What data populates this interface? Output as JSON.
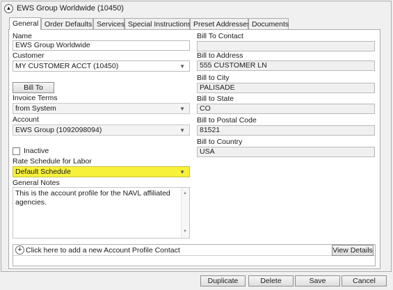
{
  "window": {
    "title": "EWS Group Worldwide (10450)"
  },
  "tabs": [
    {
      "label": "General",
      "active": true
    },
    {
      "label": "Order Defaults"
    },
    {
      "label": "Services"
    },
    {
      "label": "Special Instructions"
    },
    {
      "label": "Preset Addresses"
    },
    {
      "label": "Documents"
    }
  ],
  "general": {
    "name_label": "Name",
    "name_value": "EWS Group Worldwide",
    "customer_label": "Customer",
    "customer_value": "MY CUSTOMER ACCT (10450)",
    "bill_to_button": "Bill To",
    "invoice_terms_label": "Invoice Terms",
    "invoice_terms_value": "from System",
    "account_label": "Account",
    "account_value": "EWS Group (1092098094)",
    "inactive_label": "Inactive",
    "inactive_checked": false,
    "rate_schedule_label": "Rate Schedule for Labor",
    "rate_schedule_value": "Default Schedule",
    "rate_schedule_highlight_color": "#f7f13a",
    "notes_label": "General Notes",
    "notes_value": "This is the account profile for the NAVL affiliated agencies."
  },
  "bill_to": {
    "contact_label": "Bill To Contact",
    "contact_value": "",
    "address_label": "Bill to Address",
    "address_value": "555 CUSTOMER LN",
    "city_label": "Bill to City",
    "city_value": "PALISADE",
    "state_label": "Bill to State",
    "state_value": "CO",
    "postal_label": "Bill to Postal Code",
    "postal_value": "81521",
    "country_label": "Bill to Country",
    "country_value": "USA"
  },
  "contacts": {
    "add_text": "Click here to add a new Account Profile Contact",
    "view_details": "View Details"
  },
  "footer": {
    "duplicate": "Duplicate",
    "delete": "Delete",
    "save": "Save",
    "cancel": "Cancel"
  },
  "icons": {
    "collapse": "chevron-up-circle-icon",
    "add_contact": "plus-circle-icon",
    "dropdown": "chevron-down-icon"
  }
}
